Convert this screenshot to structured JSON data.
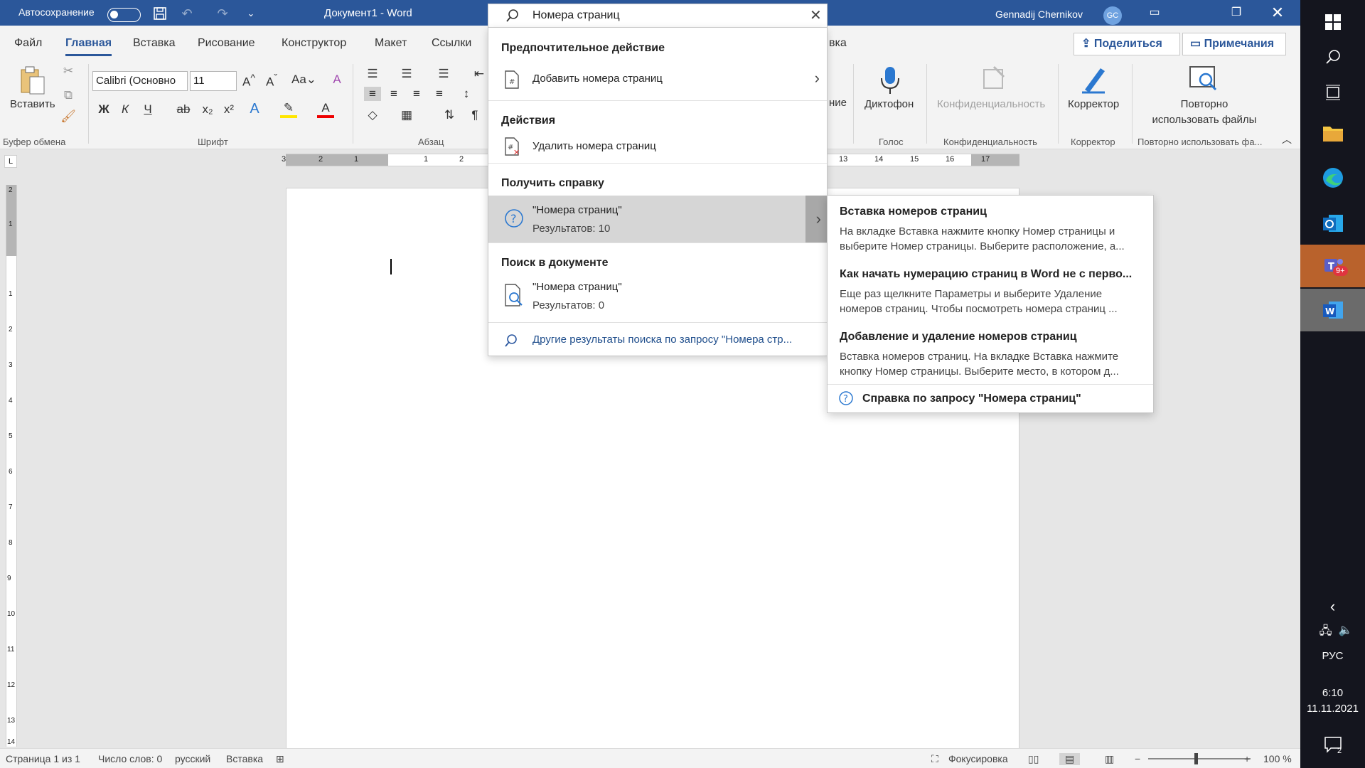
{
  "titlebar": {
    "autosave_label": "Автосохранение",
    "title": "Документ1  -  Word",
    "user_name": "Gennadij Chernikov",
    "avatar_initials": "GC"
  },
  "tabs": [
    "Файл",
    "Главная",
    "Вставка",
    "Рисование",
    "Конструктор",
    "Макет",
    "Ссылки"
  ],
  "tabs_tail": "вка",
  "share_label": "Поделиться",
  "notes_label": "Примечания",
  "ribbon": {
    "paste_label": "Вставить",
    "font_name": "Calibri (Основно",
    "font_size": "11",
    "groups": {
      "clipboard": "Буфер обмена",
      "font": "Шрифт",
      "paragraph": "Абзац",
      "voice": "Голос",
      "privacy": "Конфиденциальность",
      "editor": "Корректор",
      "reuse": "Повторно использовать фа..."
    },
    "editing_tail": "ние",
    "dictate_label": "Диктофон",
    "privacy_label": "Конфиденциальность",
    "editor_label": "Корректор",
    "reuse_line1": "Повторно",
    "reuse_line2": "использовать файлы",
    "bold": "Ж",
    "italic": "К",
    "underline": "Ч"
  },
  "ruler": {
    "h_marks": [
      "3",
      "2",
      "1",
      "1",
      "2",
      "13",
      "14",
      "15",
      "16",
      "17"
    ],
    "v_marks": [
      "2",
      "1",
      "1",
      "2",
      "3",
      "4",
      "5",
      "6",
      "7",
      "8",
      "9",
      "10",
      "11",
      "12",
      "13",
      "14"
    ]
  },
  "search": {
    "value": "Номера страниц",
    "sections": {
      "preferred": "Предпочтительное действие",
      "actions": "Действия",
      "help": "Получить справку",
      "in_doc": "Поиск в документе"
    },
    "add_page_numbers": "Добавить номера страниц",
    "remove_page_numbers": "Удалить номера страниц",
    "help_query": "\"Номера страниц\"",
    "help_results": "Результатов: 10",
    "doc_query": "\"Номера страниц\"",
    "doc_results": "Результатов: 0",
    "more_results": "Другие результаты поиска по запросу \"Номера стр..."
  },
  "flyout": {
    "items": [
      {
        "title": "Вставка номеров страниц",
        "body1": "На вкладке Вставка нажмите кнопку Номер страницы и",
        "body2": "выберите Номер страницы. Выберите расположение, а..."
      },
      {
        "title": "Как начать нумерацию страниц в Word не с перво...",
        "body1": "Еще раз щелкните Параметры и выберите Удаление",
        "body2": "номеров страниц. Чтобы посмотреть номера страниц ..."
      },
      {
        "title": "Добавление и удаление номеров страниц",
        "body1": "Вставка номеров страниц. На вкладке Вставка нажмите",
        "body2": "кнопку Номер страницы. Выберите место, в котором д..."
      }
    ],
    "help_link": "Справка по запросу \"Номера страниц\""
  },
  "statusbar": {
    "page": "Страница 1 из 1",
    "words": "Число слов: 0",
    "language": "русский",
    "mode": "Вставка",
    "focus": "Фокусировка",
    "zoom": "100 %"
  },
  "taskbar": {
    "language": "РУС",
    "time": "6:10",
    "date": "11.11.2021",
    "teams_badge": "9+",
    "notifications": "2"
  },
  "colors": {
    "accent": "#2b579a",
    "taskbar": "#14151e"
  }
}
